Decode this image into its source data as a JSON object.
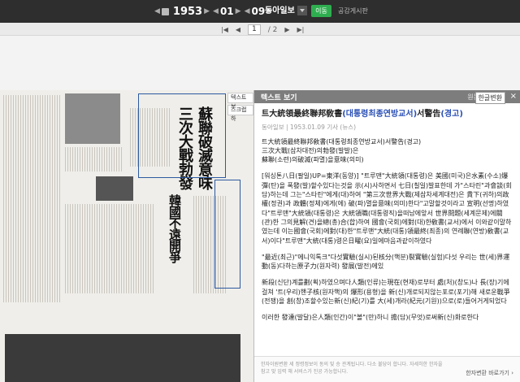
{
  "toolbar": {
    "year": "1953",
    "month": "01",
    "day": "09",
    "publisher": "동아일보",
    "go_label": "이동",
    "share_label": "공감게시판"
  },
  "pager": {
    "current": "1",
    "total": "/ 2"
  },
  "side_tabs": [
    "텍스트 보",
    "스크랩 하"
  ],
  "panel": {
    "title": "텍스트 보기",
    "tab_original": "원문",
    "tab_modern": "한글변환",
    "close": "×",
    "article_title_prefix": "트大統領最終聯邦敎書",
    "article_title_hl": "(대통령최종연방교서)",
    "article_title_mid": "서警告",
    "article_title_hl2": "(경고)",
    "meta": "동아일보 | 1953.01.09 기사 (뉴스)",
    "lines": [
      "트大統領最終聯邦敎書(대통령최종연방교서)서警告(경고)",
      "三次大戰(삼차대전)의勃發(발발)은",
      "蘇聯(소련)의破滅(파멸)을意味(의미)",
      "[워싱톤八日(팔일)UP=東洋(동양)] \"트루맨\"大統領(대통령)은 美國(미국)은水素(수소)爆彈(탄)을 폭發(발)할수있다는것을 示(시)사하면서 七日(칠일)발표한데 가\"스타린\"과會談(회담)하는데 그는\"스타린\"에게(대)하여 \"第三次世界大戰(제삼차세계대전)은 貴下(귀하)의政權(정권)과 政體(정체)에게(에) 破(파)멸을意味(의미)한다\"고말할것이라고 宣明(선명)하였다\"트루맨\"大統領(대통령)은 大統領職(대통령직)을떠남에앞서 世界問題(세계문제)에關(관)한 그의見解(견)을總(총)合(합)하여 國會(국회)에對(대)한敎書(교서)에서 이와같이말하였는데 이는國會(국회)에對(대)한\"트루맨\"大統(대통)領最終(최종)의 연례聯(연방)敎書(교서)이다\"트루맨\"大統(대통)령은日曜(요)일에마음과같이하였다",
      "\"最近(최근)\"에니익톡크\"다섯實驗(실시)된核分(핵분)裂實驗(실험)다섯 우리는 世(세)界運動(동)다하는原子力(원자력) 發展(발전)에있",
      "新段(신단)계를劃(획)하였으며다人類(인류)는現在(현재)로부터 處(처)(창도)나 長(장)기에걸쳐 '트(우리)핸子核(원자핵)의 爆形(용형)을 新(신)개로되지않는포로(포기)해 새로운戰爭(전쟁)을 創(창)조할수있는新(신)紀(기)를 大(세)개라(紀元(기원))으로(로)들어거게되었다",
      "이러한 發達(발달)은人類(인간)이\"볼\"(만)하니 擔(담)(무엇)로써新(신)화로한다"
    ],
    "footer_note": "한자이원변환 세 정령정보이 동의 및 승 관계됩니다. 다소 불당이 합니다. 자세히한 한자을 참고 맞 입력 해 서비스가 진공 가능합니다.",
    "footer_link": "한자변환 바로가기 ›"
  },
  "colors": {
    "topbar": "#2e2e2e",
    "go_button": "#2fae50",
    "highlight": "#2a4fb5",
    "panel_header": "#7d7d7d"
  }
}
